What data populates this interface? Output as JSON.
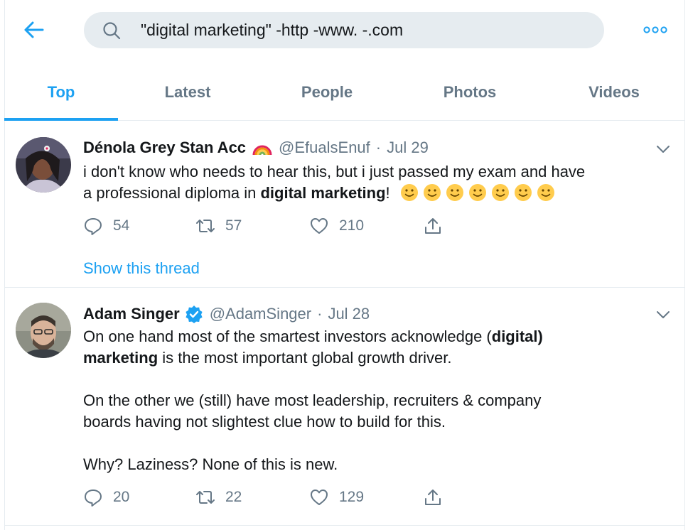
{
  "search": {
    "query": "\"digital marketing\" -http -www. -.com"
  },
  "tabs": [
    {
      "label": "Top",
      "active": true
    },
    {
      "label": "Latest",
      "active": false
    },
    {
      "label": "People",
      "active": false
    },
    {
      "label": "Photos",
      "active": false
    },
    {
      "label": "Videos",
      "active": false
    }
  ],
  "tweets": [
    {
      "name": "Dénola Grey Stan Acc",
      "name_emoji": "rainbow",
      "handle": "@EfualsEnuf",
      "separator": "·",
      "date": "Jul 29",
      "text_1": "i don't know who needs to hear this, but i just passed my exam and have",
      "text_2a": "a professional diploma in ",
      "text_2b": "digital marketing",
      "text_2c": "!",
      "emoji_count": "7",
      "replies": "54",
      "retweets": "57",
      "likes": "210",
      "thread_link": "Show this thread"
    },
    {
      "name": "Adam Singer",
      "verified": true,
      "handle": "@AdamSinger",
      "separator": "·",
      "date": "Jul 28",
      "text_1a": "On one hand most of the smartest investors acknowledge (",
      "text_1b": "digital)",
      "text_2a": "marketing",
      "text_2b": " is the most important global growth driver.",
      "text_3": "On the other we (still) have most leadership, recruiters & company",
      "text_4": "boards having not slightest clue how to build for this.",
      "text_5": "Why? Laziness? None of this is new.",
      "replies": "20",
      "retweets": "22",
      "likes": "129"
    }
  ],
  "colors": {
    "accent": "#1da1f2",
    "muted": "#657786",
    "text": "#14171a",
    "search_bg": "#e6ecf0",
    "divider": "#e6ecf0"
  },
  "icons": [
    "back-arrow-icon",
    "search-icon",
    "more-icon",
    "chevron-down-icon",
    "reply-icon",
    "retweet-icon",
    "like-icon",
    "share-icon",
    "verified-icon",
    "rainbow-icon",
    "slightly-smiling-face-icon"
  ]
}
